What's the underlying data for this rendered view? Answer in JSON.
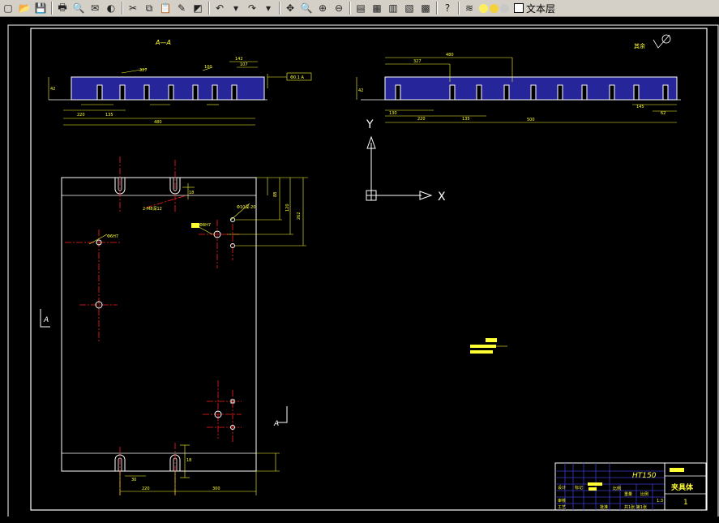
{
  "toolbar": {
    "buttons": [
      {
        "name": "new-icon",
        "glyph": "▢"
      },
      {
        "name": "open-icon",
        "glyph": "📂"
      },
      {
        "name": "save-icon",
        "glyph": "💾"
      },
      {
        "sep": true
      },
      {
        "name": "print-icon",
        "glyph": "🖶"
      },
      {
        "name": "print-preview-icon",
        "glyph": "🔍"
      },
      {
        "name": "publish-icon",
        "glyph": "✉"
      },
      {
        "name": "plot-icon",
        "glyph": "◐"
      },
      {
        "sep": true
      },
      {
        "name": "cut-icon",
        "glyph": "✂"
      },
      {
        "name": "copy-icon",
        "glyph": "⧉"
      },
      {
        "name": "paste-icon",
        "glyph": "📋"
      },
      {
        "name": "match-properties-icon",
        "glyph": "✎"
      },
      {
        "name": "block-editor-icon",
        "glyph": "◩"
      },
      {
        "sep": true
      },
      {
        "name": "undo-icon",
        "glyph": "↶"
      },
      {
        "name": "undo-dropdown-icon",
        "glyph": "▾"
      },
      {
        "name": "redo-icon",
        "glyph": "↷"
      },
      {
        "name": "redo-dropdown-icon",
        "glyph": "▾"
      },
      {
        "sep": true
      },
      {
        "name": "pan-icon",
        "glyph": "✥"
      },
      {
        "name": "zoom-realtime-icon",
        "glyph": "🔍"
      },
      {
        "name": "zoom-window-icon",
        "glyph": "⊕"
      },
      {
        "name": "zoom-previous-icon",
        "glyph": "⊖"
      },
      {
        "sep": true
      },
      {
        "name": "properties-icon",
        "glyph": "▤"
      },
      {
        "name": "design-center-icon",
        "glyph": "▦"
      },
      {
        "name": "tool-palettes-icon",
        "glyph": "▥"
      },
      {
        "name": "markup-icon",
        "glyph": "▧"
      },
      {
        "name": "calculator-icon",
        "glyph": "▩"
      },
      {
        "sep": true
      },
      {
        "name": "help-icon",
        "glyph": "?"
      },
      {
        "sep": true
      },
      {
        "name": "layer-manager-icon",
        "glyph": "≋"
      }
    ],
    "layer": {
      "name": "文本层"
    }
  },
  "drawing": {
    "section_label": "A—A",
    "roughness_label": "其余",
    "material": "HT150",
    "part_name": "夹具体",
    "quantity": "1",
    "axis_y": "Y",
    "axis_x": "X",
    "section_marker_left": "A",
    "section_marker_right": "A",
    "colors": {
      "yellow": "#ffff33",
      "white": "#ffffff",
      "red": "#ff2020",
      "blue": "#3a3acc",
      "hatch": "#26269a"
    }
  }
}
